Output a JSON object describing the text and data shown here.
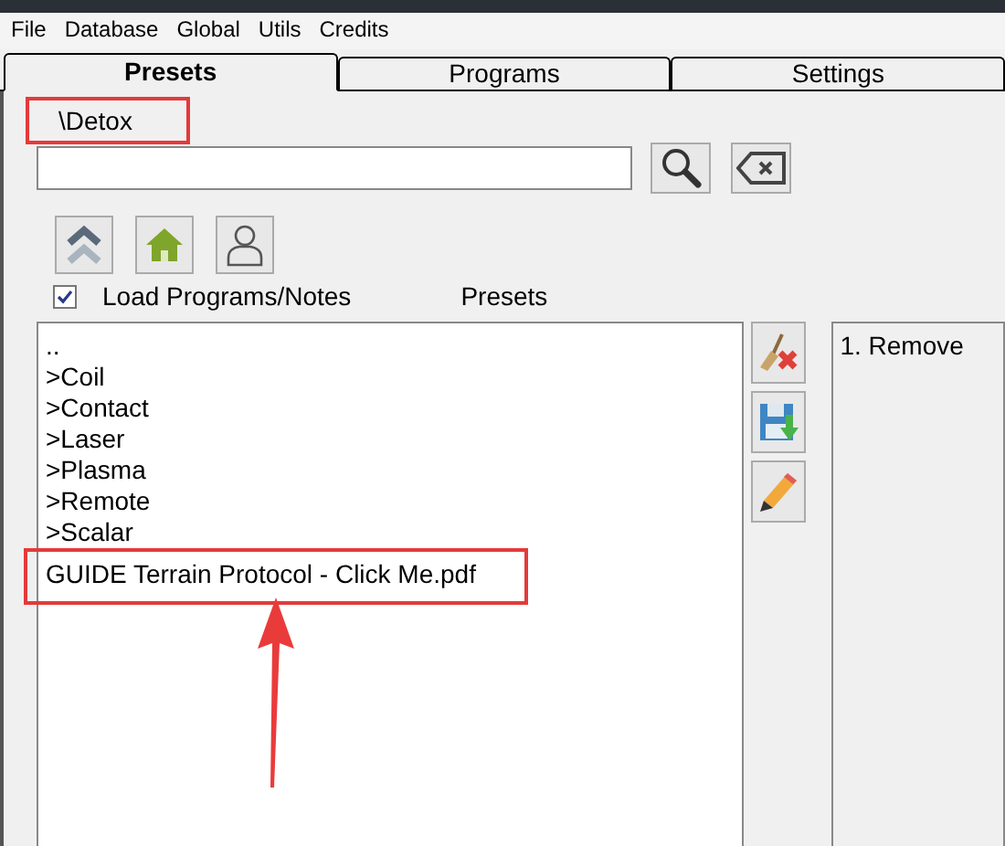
{
  "menu": [
    "File",
    "Database",
    "Global",
    "Utils",
    "Credits"
  ],
  "tabs": [
    {
      "label": "Presets",
      "selected": true
    },
    {
      "label": "Programs",
      "selected": false
    },
    {
      "label": "Settings",
      "selected": false
    }
  ],
  "path": {
    "text": "\\Detox",
    "highlighted": true
  },
  "load_programs": {
    "label": "Load Programs/Notes",
    "checked": true
  },
  "list_heading": "Presets",
  "items": [
    {
      "text": "..",
      "highlighted": false
    },
    {
      "text": ">Coil",
      "highlighted": false
    },
    {
      "text": ">Contact",
      "highlighted": false
    },
    {
      "text": ">Laser",
      "highlighted": false
    },
    {
      "text": ">Plasma",
      "highlighted": false
    },
    {
      "text": ">Remote",
      "highlighted": false
    },
    {
      "text": ">Scalar",
      "highlighted": false
    },
    {
      "text": "GUIDE Terrain Protocol - Click Me.pdf",
      "highlighted": true
    }
  ],
  "pointer_arrow": true,
  "notes": "1. Remove"
}
